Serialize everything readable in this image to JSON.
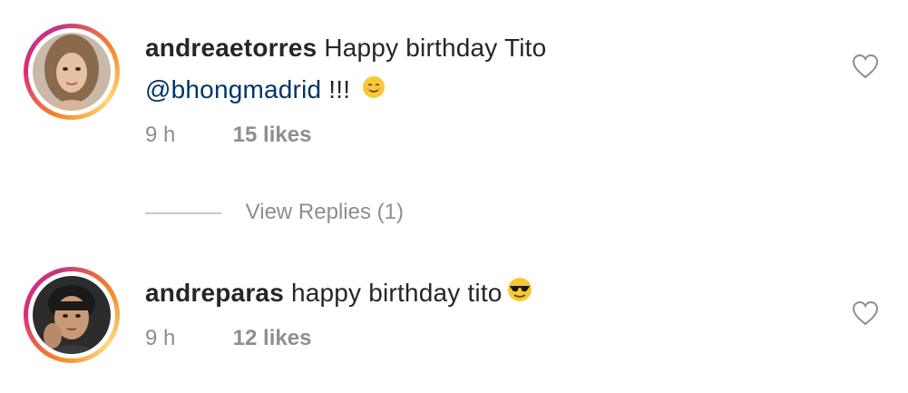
{
  "comments": [
    {
      "username": "andreaetorres",
      "text": "Happy birthday Tito",
      "mention": "@bhongmadrid",
      "after_mention": "!!!",
      "emoji": "smiling-face-emoji",
      "time": "9 h",
      "likes": "15 likes",
      "like_icon": "heart-outline-icon"
    },
    {
      "username": "andreparas",
      "text": "happy birthday tito",
      "emoji": "sunglasses-face-emoji",
      "time": "9 h",
      "likes": "12 likes",
      "like_icon": "heart-outline-icon"
    }
  ],
  "view_replies": {
    "label": "View Replies (1)"
  },
  "colors": {
    "text": "#262626",
    "secondary": "#8e8e8e",
    "mention": "#003569",
    "divider": "#c7c7c7"
  }
}
